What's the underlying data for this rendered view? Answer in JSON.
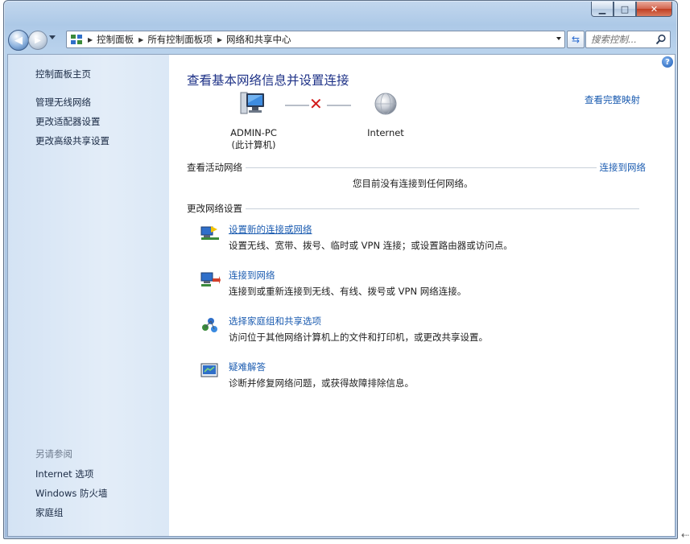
{
  "window": {
    "caption_buttons": {
      "minimize": "▁",
      "maximize": "□",
      "close": "✕"
    }
  },
  "address_bar": {
    "crumbs": [
      "控制面板",
      "所有控制面板项",
      "网络和共享中心"
    ],
    "search_placeholder": "搜索控制..."
  },
  "sidebar": {
    "links": [
      "控制面板主页",
      "管理无线网络",
      "更改适配器设置",
      "更改高级共享设置"
    ],
    "see_also_label": "另请参阅",
    "see_also_links": [
      "Internet 选项",
      "Windows 防火墙",
      "家庭组"
    ]
  },
  "main": {
    "title": "查看基本网络信息并设置连接",
    "view_full_map": "查看完整映射",
    "network_map": {
      "computer_name": "ADMIN-PC",
      "computer_sub": "(此计算机)",
      "internet_label": "Internet",
      "status": "disconnected"
    },
    "active_networks": {
      "heading": "查看活动网络",
      "connect_link": "连接到网络",
      "empty_message": "您目前没有连接到任何网络。"
    },
    "change_settings": {
      "heading": "更改网络设置",
      "tasks": [
        {
          "icon": "network-setup-icon",
          "title": "设置新的连接或网络",
          "description": "设置无线、宽带、拨号、临时或 VPN 连接；或设置路由器或访问点。"
        },
        {
          "icon": "connect-network-icon",
          "title": "连接到网络",
          "description": "连接到或重新连接到无线、有线、拨号或 VPN 网络连接。"
        },
        {
          "icon": "homegroup-icon",
          "title": "选择家庭组和共享选项",
          "description": "访问位于其他网络计算机上的文件和打印机，或更改共享设置。"
        },
        {
          "icon": "troubleshoot-icon",
          "title": "疑难解答",
          "description": "诊断并修复网络问题，或获得故障排除信息。"
        }
      ]
    }
  },
  "colors": {
    "link": "#1a5bb0",
    "title": "#1e3287",
    "error_x": "#d21a1a",
    "sidebar_bg": "#dbe8f6"
  }
}
